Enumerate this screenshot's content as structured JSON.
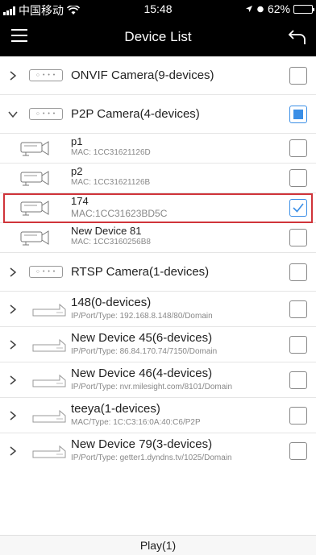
{
  "status_bar": {
    "carrier": "中国移动",
    "time": "15:48",
    "battery": "62%",
    "battery_level": 0.62
  },
  "nav": {
    "title": "Device List"
  },
  "groups": [
    {
      "name": "ONVIF Camera(9-devices)",
      "icon": "onvif-device-icon",
      "icon_text": "○ • • •",
      "expanded": false,
      "checkbox": "unchecked"
    },
    {
      "name": "P2P Camera(4-devices)",
      "icon": "p2p-device-icon",
      "icon_text": "○ • • •",
      "expanded": true,
      "checkbox": "partial"
    },
    {
      "name": "RTSP Camera(1-devices)",
      "icon": "rtsp-device-icon",
      "icon_text": "○ • • •",
      "expanded": false,
      "checkbox": "unchecked"
    }
  ],
  "p2p_devices": [
    {
      "name": "p1",
      "mac": "MAC: 1CC31621126D",
      "checked": false
    },
    {
      "name": "p2",
      "mac": "MAC: 1CC31621126B",
      "checked": false
    },
    {
      "name": "174",
      "mac": "MAC:1CC31623BD5C",
      "checked": true
    },
    {
      "name": "New Device 81",
      "mac": "MAC: 1CC3160256B8",
      "checked": false
    }
  ],
  "nvr_devices": [
    {
      "name": "148(0-devices)",
      "detail": "IP/Port/Type: 192.168.8.148/80/Domain"
    },
    {
      "name": "New Device 45(6-devices)",
      "detail": "IP/Port/Type: 86.84.170.74/7150/Domain"
    },
    {
      "name": "New Device 46(4-devices)",
      "detail": "IP/Port/Type: nvr.milesight.com/8101/Domain"
    },
    {
      "name": "teeya(1-devices)",
      "detail": "MAC/Type: 1C:C3:16:0A:40:C6/P2P"
    },
    {
      "name": "New Device 79(3-devices)",
      "detail": "IP/Port/Type: getter1.dyndns.tv/1025/Domain"
    }
  ],
  "footer": {
    "play_label": "Play(1)"
  },
  "colors": {
    "accent": "#3a8ee6",
    "highlight": "#d0343a",
    "bar": "#000000"
  }
}
